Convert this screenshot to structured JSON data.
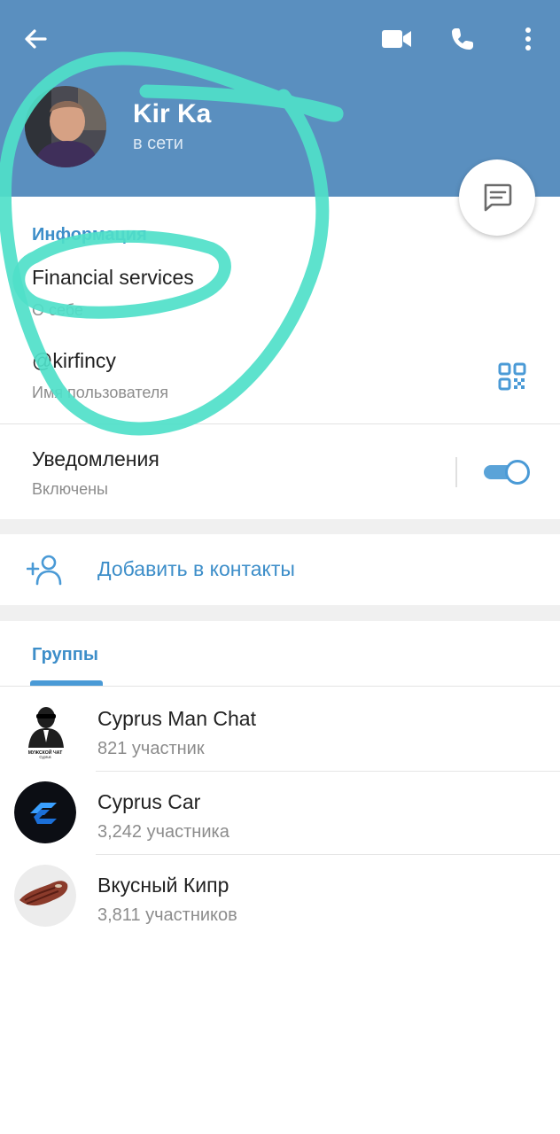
{
  "header": {
    "name": "Kir Ka",
    "status": "в сети",
    "background_color": "#5a8fbf"
  },
  "info": {
    "section_title": "Информация",
    "bio_value": "Financial services",
    "bio_label": "О себе",
    "username_value": "@kirfincy",
    "username_label": "Имя пользователя",
    "notifications_label": "Уведомления",
    "notifications_state": "Включены",
    "notifications_enabled": true
  },
  "add_contact": {
    "label": "Добавить в контакты"
  },
  "tabs": {
    "groups_label": "Группы"
  },
  "groups": [
    {
      "name": "Cyprus Man Chat",
      "members": "821 участник",
      "avatar_text_1": "МУЖСКОЙ ЧАТ",
      "avatar_text_2": "Cyprus"
    },
    {
      "name": "Cyprus Car",
      "members": "3,242 участника"
    },
    {
      "name": "Вкусный Кипр",
      "members": "3,811 участников"
    }
  ],
  "icons": {
    "back": "arrow-left-icon",
    "video": "video-camera-icon",
    "call": "phone-icon",
    "more": "more-vertical-icon",
    "message": "message-icon",
    "qr": "qr-code-icon",
    "add_contact": "add-person-icon"
  },
  "colors": {
    "accent": "#3d8ec9",
    "annotation": "#4fdfc9",
    "toggle_on": "#5aa3d8"
  }
}
